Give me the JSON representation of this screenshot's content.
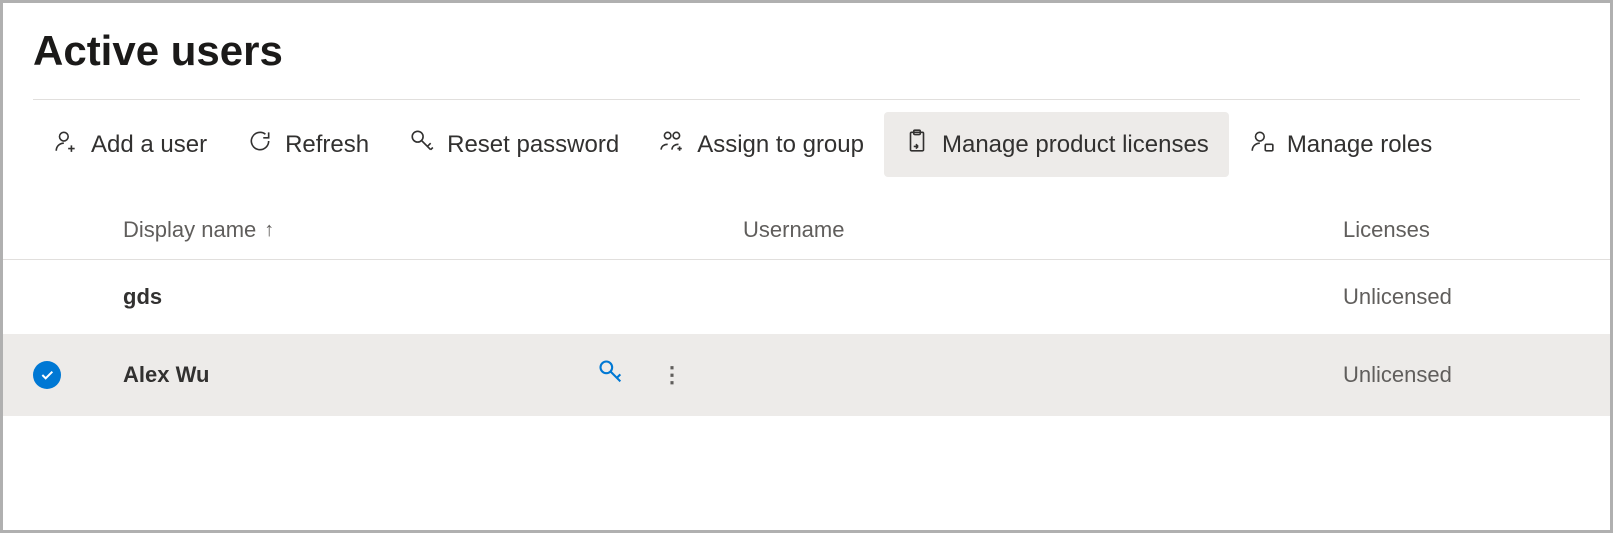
{
  "page": {
    "title": "Active users"
  },
  "toolbar": {
    "add_user": "Add a user",
    "refresh": "Refresh",
    "reset_password": "Reset password",
    "assign_group": "Assign to group",
    "manage_licenses": "Manage product licenses",
    "manage_roles": "Manage roles"
  },
  "columns": {
    "display_name": "Display name",
    "username": "Username",
    "licenses": "Licenses"
  },
  "sort_indicator": "↑",
  "rows": [
    {
      "selected": false,
      "display_name": "gds",
      "username": "",
      "licenses": "Unlicensed"
    },
    {
      "selected": true,
      "display_name": "Alex Wu",
      "username": "",
      "licenses": "Unlicensed"
    }
  ]
}
